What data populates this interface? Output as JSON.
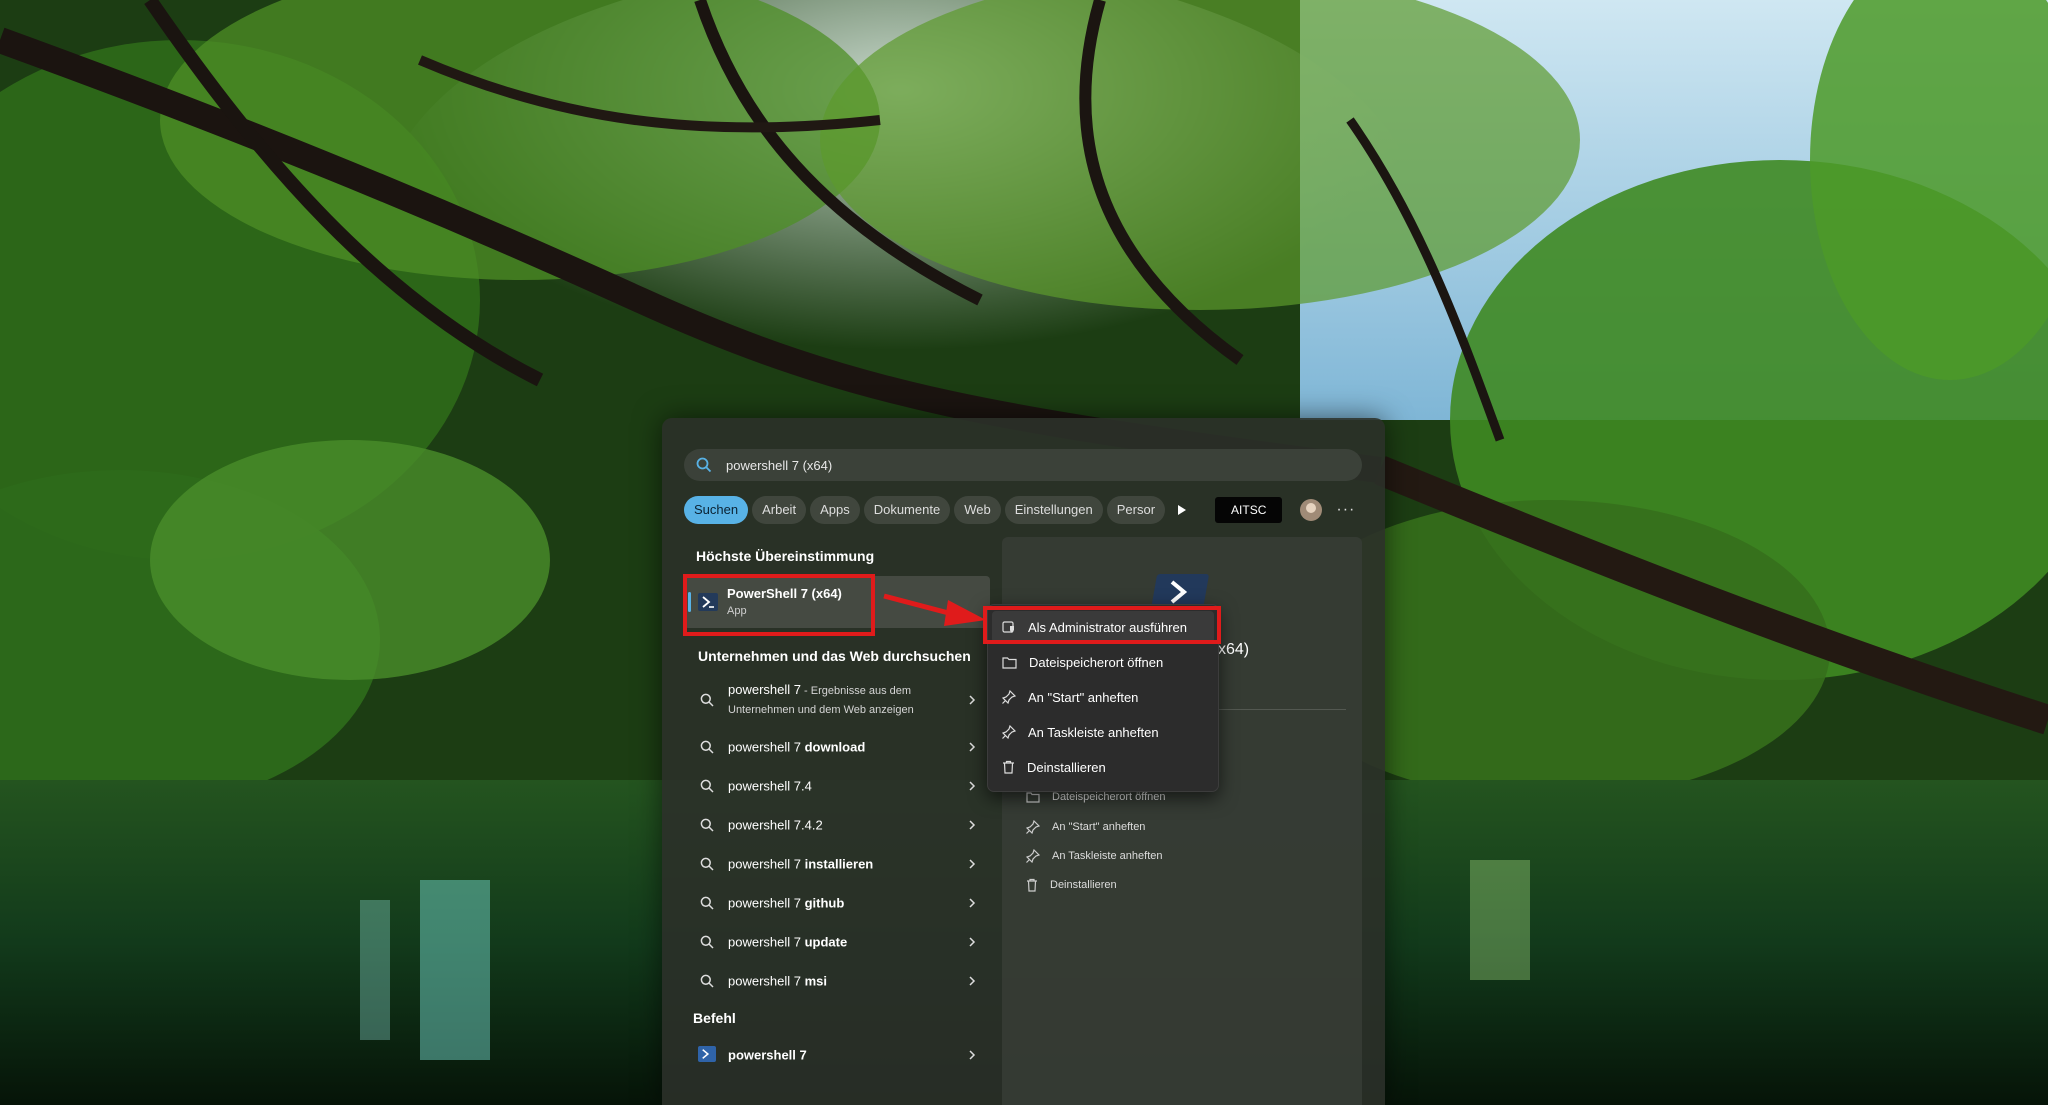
{
  "search": {
    "query": "powershell 7 (x64)"
  },
  "tabs": {
    "items": [
      "Suchen",
      "Arbeit",
      "Apps",
      "Dokumente",
      "Web",
      "Einstellungen",
      "Persor"
    ],
    "org_badge": "AITSC",
    "more": "···"
  },
  "best_match": {
    "section_title": "Höchste Übereinstimmung",
    "name": "PowerShell 7 (x64)",
    "type": "App"
  },
  "web_search": {
    "section_title": "Unternehmen und das Web durchsuchen",
    "first": {
      "term": "powershell 7",
      "suffix_line1": " - Ergebnisse aus dem",
      "line2": "Unternehmen und dem Web anzeigen"
    },
    "items": [
      {
        "prefix": "powershell 7 ",
        "bold": "download"
      },
      {
        "prefix": "powershell 7.4",
        "bold": ""
      },
      {
        "prefix": "powershell 7.4.2",
        "bold": ""
      },
      {
        "prefix": "powershell 7 ",
        "bold": "installieren"
      },
      {
        "prefix": "powershell 7 ",
        "bold": "github"
      },
      {
        "prefix": "powershell 7 ",
        "bold": "update"
      },
      {
        "prefix": "powershell 7 ",
        "bold": "msi"
      }
    ]
  },
  "command": {
    "section_title": "Befehl",
    "item": "powershell 7"
  },
  "detail": {
    "title_suffix": "x64)",
    "actions": [
      "Dateispeicherort öffnen",
      "An \"Start\" anheften",
      "An Taskleiste anheften",
      "Deinstallieren"
    ]
  },
  "context_menu": {
    "items": [
      {
        "label": "Als Administrator ausführen",
        "icon": "admin-shield-icon"
      },
      {
        "label": "Dateispeicherort öffnen",
        "icon": "folder-icon"
      },
      {
        "label": "An \"Start\" anheften",
        "icon": "pin-icon"
      },
      {
        "label": "An Taskleiste anheften",
        "icon": "pin-icon"
      },
      {
        "label": "Deinstallieren",
        "icon": "trash-icon"
      }
    ]
  },
  "colors": {
    "accent": "#58b2e6",
    "annotation_red": "#e01b1b",
    "panel": "#2b3029",
    "menu": "#2c2c2c"
  }
}
